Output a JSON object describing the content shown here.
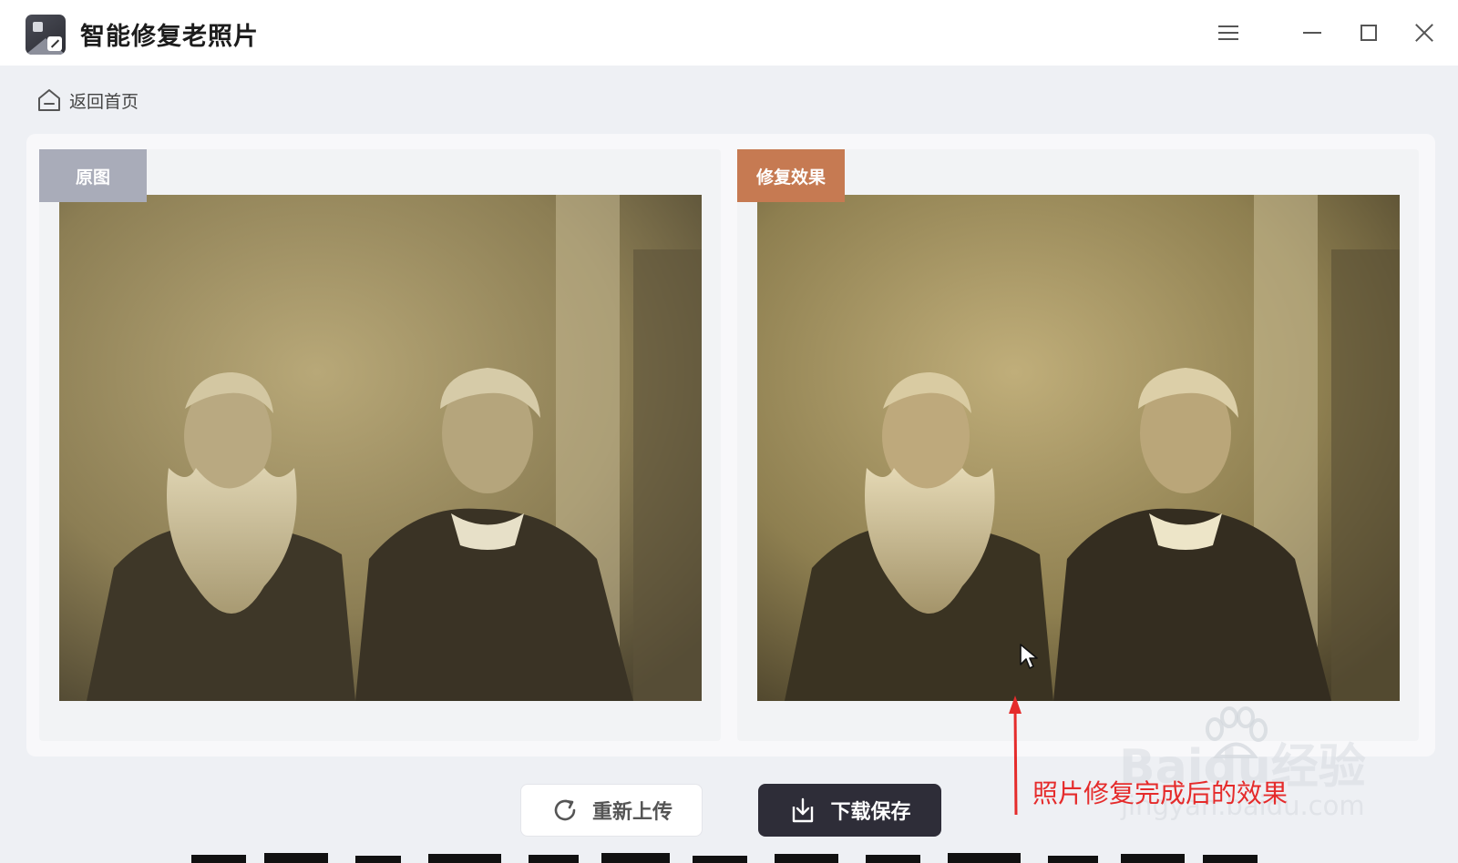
{
  "app": {
    "title": "智能修复老照片"
  },
  "nav": {
    "back_label": "返回首页"
  },
  "panels": {
    "original": {
      "label": "原图"
    },
    "restored": {
      "label": "修复效果"
    }
  },
  "actions": {
    "reupload_label": "重新上传",
    "download_label": "下载保存"
  },
  "annotation": {
    "text": "照片修复完成后的效果"
  },
  "watermark": {
    "brand": "Baidu经验",
    "url": "jingyan.baidu.com"
  },
  "colors": {
    "accent_dark": "#2e2d38",
    "tag_original": "#a9acb9",
    "tag_restored": "#c67a52",
    "annotation_red": "#e52b2b"
  },
  "icons": [
    "app-logo",
    "menu-icon",
    "minimize-icon",
    "maximize-icon",
    "close-icon",
    "home-icon",
    "refresh-icon",
    "download-icon",
    "cursor-icon"
  ]
}
